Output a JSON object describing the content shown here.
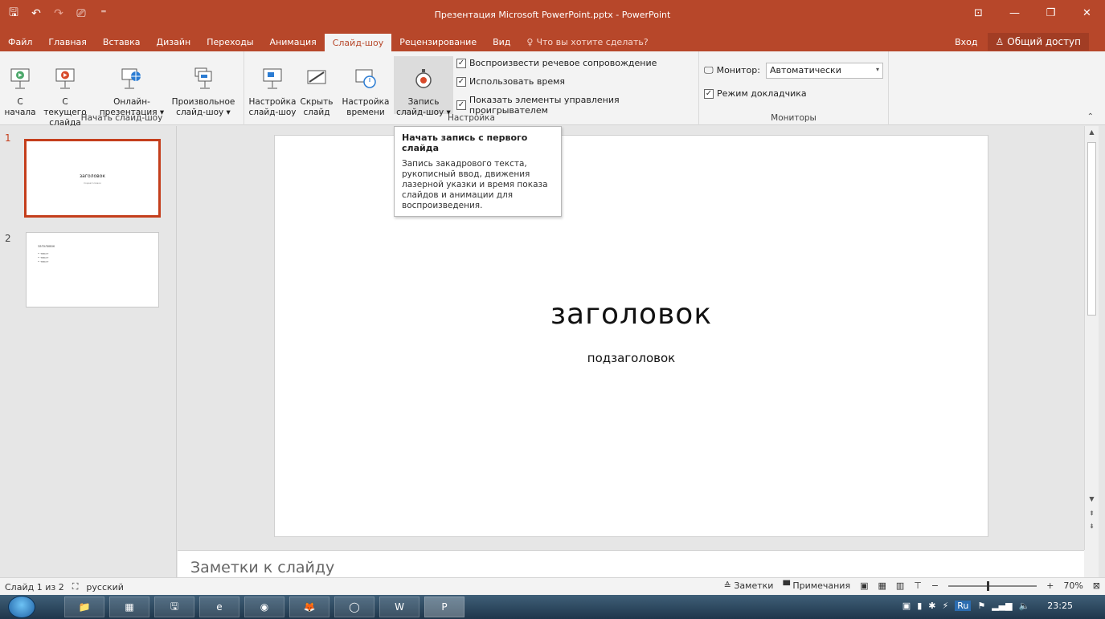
{
  "window": {
    "title": "Презентация Microsoft PowerPoint.pptx - PowerPoint",
    "qat": {
      "save": "🖫",
      "undo": "↶",
      "redo": "↷",
      "start": "⎚",
      "customize": "⁼"
    },
    "controls": {
      "ribbon_options": "⊡",
      "minimize": "—",
      "restore": "❐",
      "close": "✕"
    }
  },
  "tabs": [
    {
      "label": "Файл"
    },
    {
      "label": "Главная"
    },
    {
      "label": "Вставка"
    },
    {
      "label": "Дизайн"
    },
    {
      "label": "Переходы"
    },
    {
      "label": "Анимация"
    },
    {
      "label": "Слайд-шоу",
      "active": true
    },
    {
      "label": "Рецензирование"
    },
    {
      "label": "Вид"
    }
  ],
  "search_hint": "Что вы хотите сделать?",
  "account": {
    "signin": "Вход",
    "share": "Общий доступ"
  },
  "ribbon": {
    "start_group": {
      "label": "Начать слайд-шоу",
      "from_start": "С\nначала",
      "from_current": "С текущего\nслайда",
      "online": "Онлайн-\nпрезентация ▾",
      "custom": "Произвольное\nслайд-шоу ▾"
    },
    "setup_group": {
      "label": "Настройка",
      "setup": "Настройка\nслайд-шоу",
      "hide": "Скрыть\nслайд",
      "rehearse": "Настройка\nвремени",
      "record": "Запись\nслайд-шоу ▾",
      "checks": [
        {
          "label": "Воспроизвести речевое сопровождение",
          "checked": true
        },
        {
          "label": "Использовать время",
          "checked": true
        },
        {
          "label": "Показать элементы управления проигрывателем",
          "checked": true
        }
      ]
    },
    "monitors_group": {
      "label": "Мониторы",
      "monitor_label": "Монитор:",
      "monitor_value": "Автоматически",
      "presenter_view": "Режим докладчика",
      "presenter_checked": true
    }
  },
  "tooltip": {
    "title": "Начать запись с первого слайда",
    "body": "Запись закадрового текста, рукописный ввод, движения лазерной указки и время показа слайдов и анимации для воспроизведения."
  },
  "thumbnails": [
    {
      "num": "1",
      "title": "заголовок",
      "subtitle": "подзаголовок"
    },
    {
      "num": "2",
      "title": "заголовок",
      "bullets": [
        "• текст",
        "• текст",
        "• текст"
      ]
    }
  ],
  "slide": {
    "title": "заголовок",
    "subtitle": "подзаголовок"
  },
  "notes_placeholder": "Заметки к слайду",
  "status": {
    "slide_info": "Слайд 1 из 2",
    "language": "русский",
    "notes": "Заметки",
    "comments": "Примечания",
    "zoom": "70%"
  },
  "taskbar": {
    "apps": [
      "📁",
      "▦",
      "🖫",
      "e",
      "◉",
      "🦊",
      "◯",
      "W",
      "P"
    ],
    "tray_lang": "Ru",
    "time": "23:25"
  }
}
